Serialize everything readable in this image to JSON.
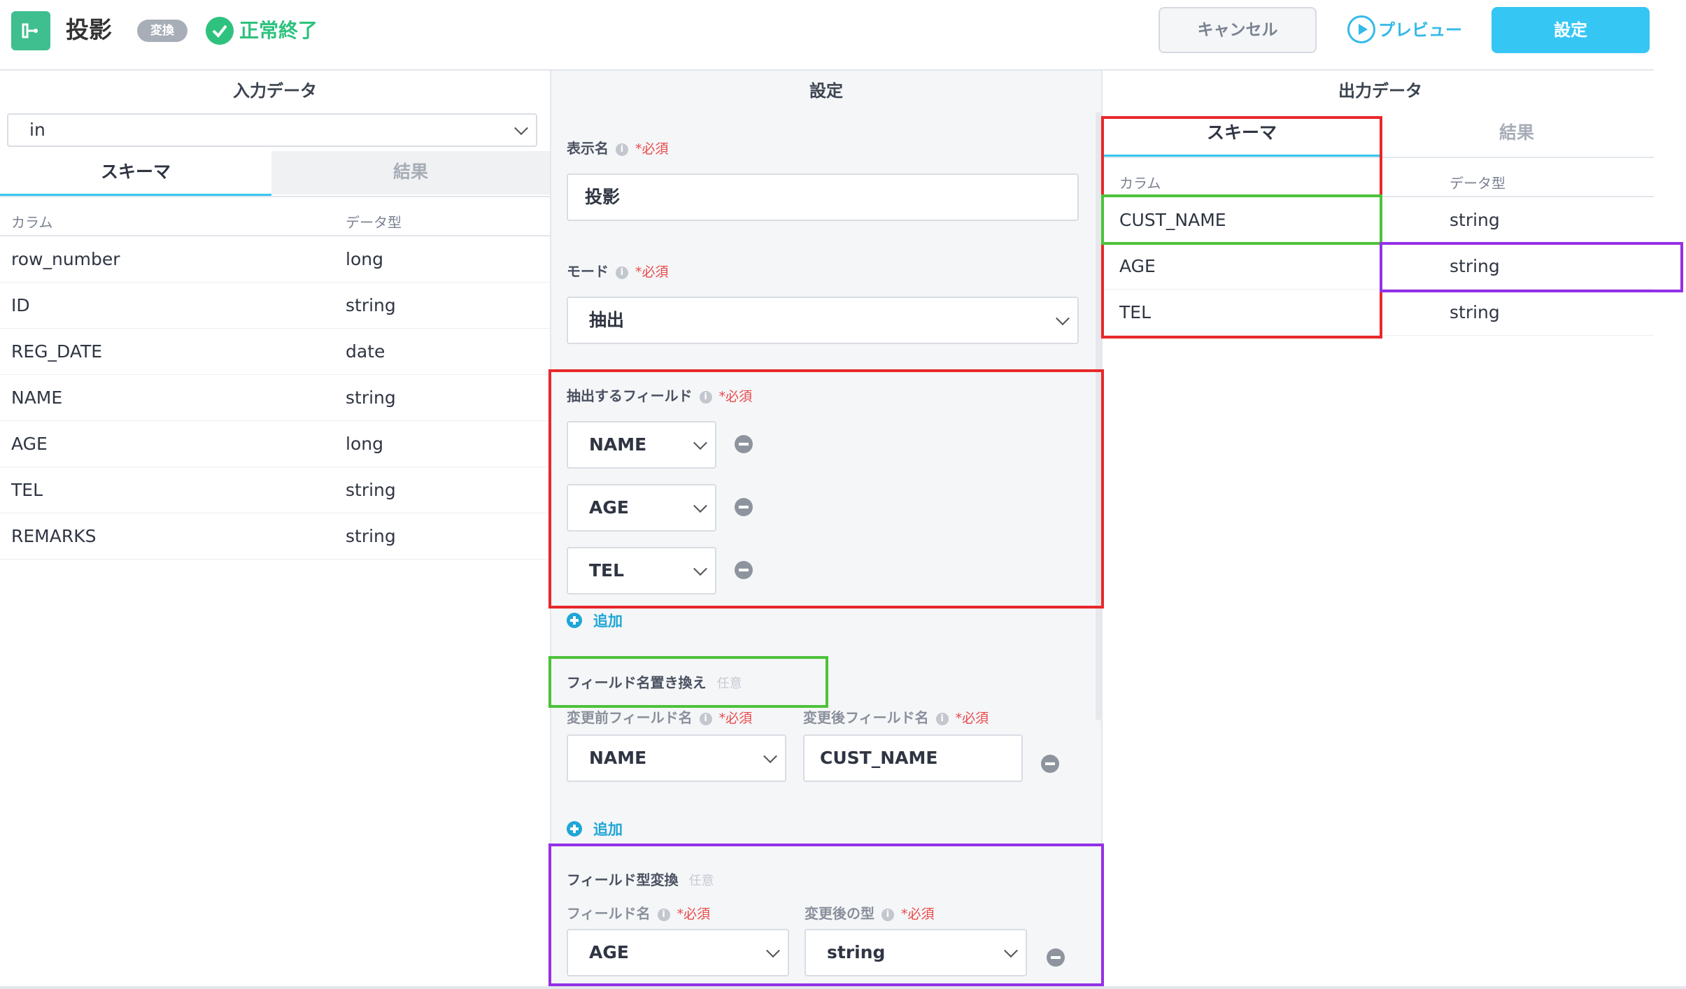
{
  "header": {
    "title": "投影",
    "badge": "変換",
    "status": "正常終了",
    "cancel_label": "キャンセル",
    "preview_label": "プレビュー",
    "save_label": "設定"
  },
  "input_panel": {
    "title": "入力データ",
    "source_select": "in",
    "tabs": [
      "スキーマ",
      "結果"
    ],
    "columns": [
      "カラム",
      "データ型"
    ],
    "rows": [
      [
        "row_number",
        "long"
      ],
      [
        "ID",
        "string"
      ],
      [
        "REG_DATE",
        "date"
      ],
      [
        "NAME",
        "string"
      ],
      [
        "AGE",
        "long"
      ],
      [
        "TEL",
        "string"
      ],
      [
        "REMARKS",
        "string"
      ]
    ]
  },
  "settings_panel": {
    "title": "設定",
    "required": "*必須",
    "optional": "任意",
    "add_label": "追加",
    "display_name_label": "表示名",
    "display_name_value": "投影",
    "mode_label": "モード",
    "mode_value": "抽出",
    "extract_label": "抽出するフィールド",
    "extract_fields": [
      "NAME",
      "AGE",
      "TEL"
    ],
    "rename_label": "フィールド名置き換え",
    "rename_before_label": "変更前フィールド名",
    "rename_after_label": "変更後フィールド名",
    "rename_before_value": "NAME",
    "rename_after_value": "CUST_NAME",
    "cast_label": "フィールド型変換",
    "cast_field_label": "フィールド名",
    "cast_type_label": "変更後の型",
    "cast_field_value": "AGE",
    "cast_type_value": "string"
  },
  "output_panel": {
    "title": "出力データ",
    "tabs": [
      "スキーマ",
      "結果"
    ],
    "columns": [
      "カラム",
      "データ型"
    ],
    "rows": [
      [
        "CUST_NAME",
        "string"
      ],
      [
        "AGE",
        "string"
      ],
      [
        "TEL",
        "string"
      ]
    ]
  },
  "colors": {
    "accent": "#35c6f4",
    "success": "#2ec27e",
    "annotation_red": "#e8282a",
    "annotation_green": "#4dc23b",
    "annotation_purple": "#9430e6"
  }
}
